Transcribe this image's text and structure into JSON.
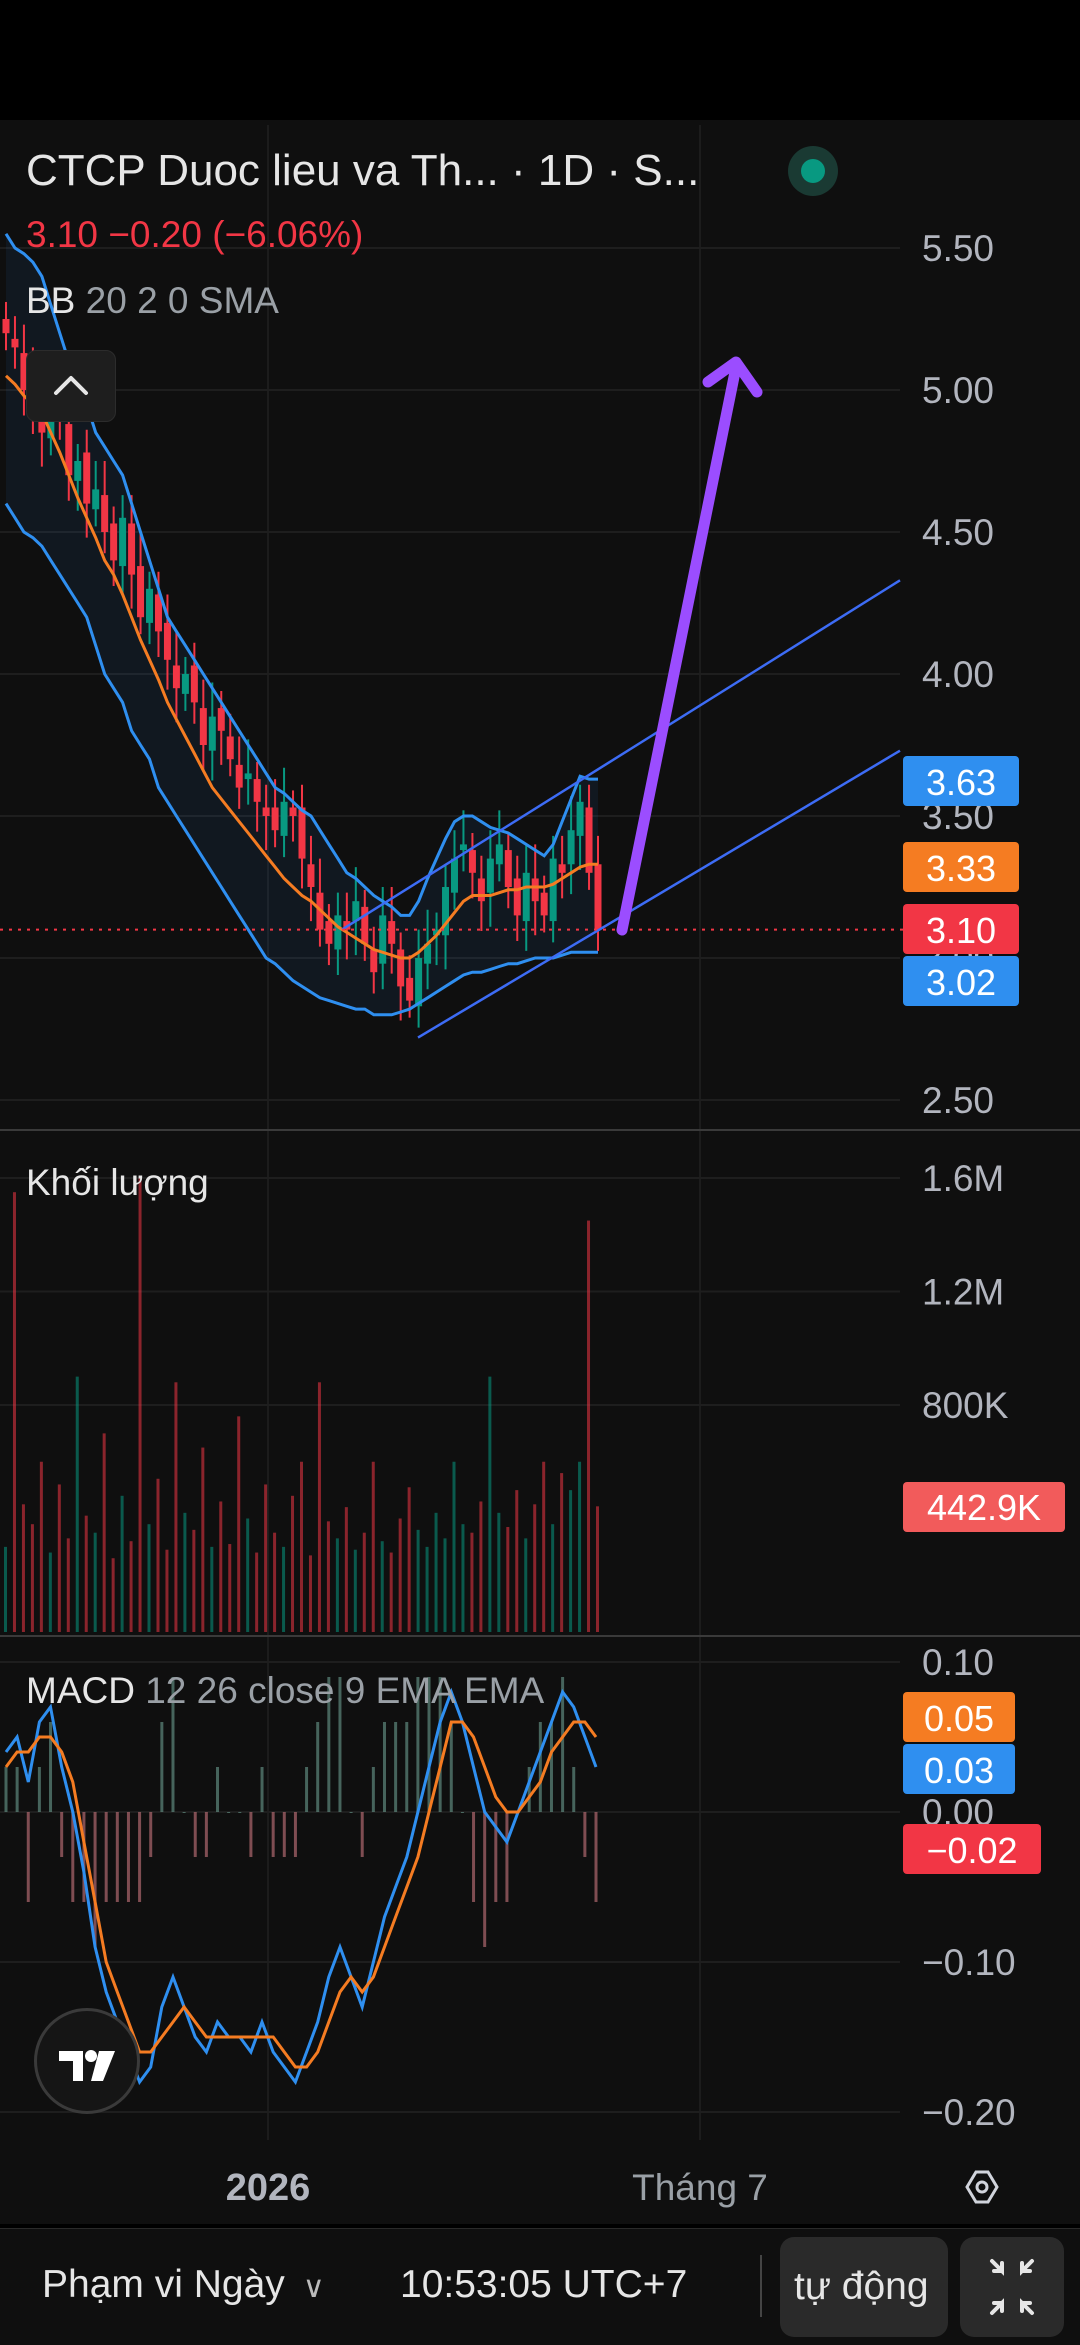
{
  "header": {
    "title": "CTCP Duoc lieu va Th...",
    "interval": "1D",
    "exchange": "S...",
    "price_change": "3.10  −0.20 (−6.06%)",
    "indicator_name": "BB",
    "indicator_params": "20 2 0 SMA"
  },
  "volume_pane": {
    "label": "Khối lượng"
  },
  "macd_pane": {
    "label": "MACD",
    "params": "12 26 close 9 EMA EMA"
  },
  "time_axis": {
    "labels": [
      "2026",
      "Tháng 7"
    ]
  },
  "bottom_bar": {
    "range_label": "Phạm vi Ngày",
    "time": "10:53:05 UTC+7",
    "auto_label": "tự động"
  },
  "colors": {
    "up": "#089981",
    "down": "#f23645",
    "bb_line": "#2f8ff0",
    "basis": "#f57c22",
    "channel": "#3d6cf5",
    "arrow": "#9b4dff",
    "macd": "#2f8ff0",
    "signal": "#f57c22"
  },
  "chart_data": [
    {
      "type": "candlestick",
      "title": "CTCP Duoc lieu va Th... · 1D · S...",
      "indicator": "BB 20 2 0 SMA",
      "y_axis_ticks": [
        2.5,
        3.0,
        3.5,
        4.0,
        4.5,
        5.0,
        5.5
      ],
      "y_axis_tick_labels": [
        "2.50",
        "3.00",
        "3.50",
        "4.00",
        "4.50",
        "5.00",
        "5.50"
      ],
      "ylim": [
        2.4,
        5.75
      ],
      "last_close": 3.1,
      "change": -0.2,
      "change_pct": -6.06,
      "price_tags": [
        {
          "value": 3.63,
          "label": "3.63",
          "color": "#2f8ff0",
          "series": "BB upper"
        },
        {
          "value": 3.33,
          "label": "3.33",
          "color": "#f57c22",
          "series": "BB basis"
        },
        {
          "value": 3.1,
          "label": "3.10",
          "color": "#f23645",
          "series": "price"
        },
        {
          "value": 3.02,
          "label": "3.02",
          "color": "#2f8ff0",
          "series": "BB lower"
        }
      ],
      "closes": [
        5.2,
        5.15,
        5.0,
        4.95,
        4.85,
        5.0,
        4.9,
        4.7,
        4.75,
        4.6,
        4.65,
        4.5,
        4.4,
        4.55,
        4.35,
        4.2,
        4.3,
        4.15,
        4.05,
        3.95,
        4.0,
        3.9,
        3.75,
        3.85,
        3.8,
        3.7,
        3.6,
        3.65,
        3.55,
        3.5,
        3.45,
        3.55,
        3.5,
        3.35,
        3.25,
        3.1,
        3.05,
        3.15,
        3.1,
        3.2,
        3.05,
        2.95,
        3.15,
        3.05,
        2.9,
        2.85,
        3.0,
        3.05,
        3.1,
        3.25,
        3.35,
        3.4,
        3.3,
        3.2,
        3.35,
        3.4,
        3.25,
        3.15,
        3.3,
        3.2,
        3.15,
        3.35,
        3.3,
        3.45,
        3.55,
        3.3,
        3.1
      ],
      "bb_upper": [
        5.55,
        5.5,
        5.48,
        5.45,
        5.4,
        5.3,
        5.2,
        5.1,
        5.0,
        4.95,
        4.85,
        4.8,
        4.75,
        4.7,
        4.6,
        4.5,
        4.4,
        4.3,
        4.2,
        4.15,
        4.1,
        4.05,
        4.0,
        3.95,
        3.9,
        3.85,
        3.8,
        3.75,
        3.7,
        3.65,
        3.6,
        3.58,
        3.55,
        3.52,
        3.5,
        3.45,
        3.4,
        3.35,
        3.3,
        3.28,
        3.25,
        3.22,
        3.2,
        3.18,
        3.15,
        3.15,
        3.2,
        3.28,
        3.35,
        3.42,
        3.48,
        3.5,
        3.5,
        3.48,
        3.46,
        3.45,
        3.44,
        3.42,
        3.4,
        3.38,
        3.36,
        3.4,
        3.48,
        3.56,
        3.64,
        3.63,
        3.63
      ],
      "bb_lower": [
        4.6,
        4.55,
        4.5,
        4.48,
        4.45,
        4.4,
        4.35,
        4.3,
        4.25,
        4.2,
        4.1,
        4.0,
        3.95,
        3.9,
        3.8,
        3.75,
        3.7,
        3.6,
        3.55,
        3.5,
        3.45,
        3.4,
        3.35,
        3.3,
        3.25,
        3.2,
        3.15,
        3.1,
        3.05,
        3.0,
        2.98,
        2.95,
        2.92,
        2.9,
        2.88,
        2.86,
        2.85,
        2.84,
        2.83,
        2.82,
        2.82,
        2.8,
        2.8,
        2.8,
        2.81,
        2.82,
        2.84,
        2.86,
        2.88,
        2.9,
        2.92,
        2.94,
        2.95,
        2.95,
        2.96,
        2.97,
        2.98,
        2.98,
        2.99,
        3.0,
        3.0,
        3.0,
        3.01,
        3.02,
        3.02,
        3.02,
        3.02
      ],
      "bb_basis": [
        5.05,
        5.02,
        4.98,
        4.95,
        4.92,
        4.85,
        4.78,
        4.7,
        4.62,
        4.55,
        4.48,
        4.4,
        4.35,
        4.28,
        4.2,
        4.12,
        4.05,
        3.98,
        3.9,
        3.84,
        3.78,
        3.72,
        3.66,
        3.6,
        3.56,
        3.52,
        3.48,
        3.44,
        3.4,
        3.36,
        3.32,
        3.28,
        3.25,
        3.22,
        3.2,
        3.17,
        3.14,
        3.11,
        3.09,
        3.07,
        3.05,
        3.03,
        3.02,
        3.01,
        3.0,
        3.0,
        3.02,
        3.05,
        3.08,
        3.12,
        3.16,
        3.2,
        3.22,
        3.22,
        3.22,
        3.23,
        3.24,
        3.24,
        3.25,
        3.25,
        3.25,
        3.26,
        3.28,
        3.3,
        3.32,
        3.33,
        3.33
      ]
    },
    {
      "type": "bar",
      "title": "Khối lượng",
      "y_axis_tick_labels": [
        "800K",
        "1.2M",
        "1.6M"
      ],
      "y_axis_ticks": [
        800000,
        1200000,
        1600000
      ],
      "ylim": [
        0,
        1700000
      ],
      "last_value_label": "442.9K",
      "last_value": 442900,
      "values": [
        300000,
        1550000,
        450000,
        380000,
        600000,
        280000,
        520000,
        330000,
        900000,
        410000,
        350000,
        700000,
        260000,
        480000,
        320000,
        1600000,
        380000,
        540000,
        290000,
        880000,
        420000,
        360000,
        650000,
        300000,
        460000,
        310000,
        760000,
        400000,
        280000,
        520000,
        350000,
        300000,
        480000,
        600000,
        270000,
        880000,
        390000,
        330000,
        440000,
        290000,
        350000,
        600000,
        320000,
        280000,
        400000,
        510000,
        360000,
        300000,
        420000,
        330000,
        600000,
        380000,
        350000,
        460000,
        900000,
        420000,
        370000,
        500000,
        330000,
        450000,
        600000,
        380000,
        560000,
        500000,
        600000,
        1450000,
        442900
      ]
    },
    {
      "type": "line",
      "title": "MACD",
      "params": "12 26 close 9 EMA EMA",
      "y_axis_ticks": [
        -0.2,
        -0.1,
        0.0,
        0.1
      ],
      "y_axis_tick_labels": [
        "−0.20",
        "−0.10",
        "0.00",
        "0.10"
      ],
      "ylim": [
        -0.21,
        0.11
      ],
      "value_tags": [
        {
          "value": 0.05,
          "label": "0.05",
          "color": "#f57c22",
          "series": "Signal"
        },
        {
          "value": 0.03,
          "label": "0.03",
          "color": "#2f8ff0",
          "series": "MACD"
        },
        {
          "value": -0.02,
          "label": "−0.02",
          "color": "#f23645",
          "series": "Histogram"
        }
      ],
      "macd": [
        0.04,
        0.05,
        0.02,
        0.06,
        0.07,
        0.03,
        0.0,
        -0.04,
        -0.09,
        -0.12,
        -0.14,
        -0.16,
        -0.18,
        -0.17,
        -0.13,
        -0.11,
        -0.13,
        -0.15,
        -0.16,
        -0.14,
        -0.15,
        -0.15,
        -0.16,
        -0.14,
        -0.16,
        -0.17,
        -0.18,
        -0.16,
        -0.14,
        -0.11,
        -0.09,
        -0.11,
        -0.13,
        -0.1,
        -0.07,
        -0.05,
        -0.03,
        0.0,
        0.03,
        0.06,
        0.08,
        0.06,
        0.03,
        0.0,
        -0.01,
        -0.02,
        0.0,
        0.02,
        0.04,
        0.06,
        0.08,
        0.07,
        0.05,
        0.03
      ],
      "signal": [
        0.03,
        0.04,
        0.04,
        0.05,
        0.05,
        0.04,
        0.02,
        -0.02,
        -0.06,
        -0.1,
        -0.12,
        -0.14,
        -0.16,
        -0.16,
        -0.15,
        -0.14,
        -0.13,
        -0.14,
        -0.15,
        -0.15,
        -0.15,
        -0.15,
        -0.15,
        -0.15,
        -0.15,
        -0.16,
        -0.17,
        -0.17,
        -0.16,
        -0.14,
        -0.12,
        -0.11,
        -0.12,
        -0.11,
        -0.09,
        -0.07,
        -0.05,
        -0.03,
        0.0,
        0.03,
        0.06,
        0.06,
        0.05,
        0.03,
        0.01,
        0.0,
        0.0,
        0.01,
        0.02,
        0.04,
        0.05,
        0.06,
        0.06,
        0.05
      ]
    }
  ]
}
